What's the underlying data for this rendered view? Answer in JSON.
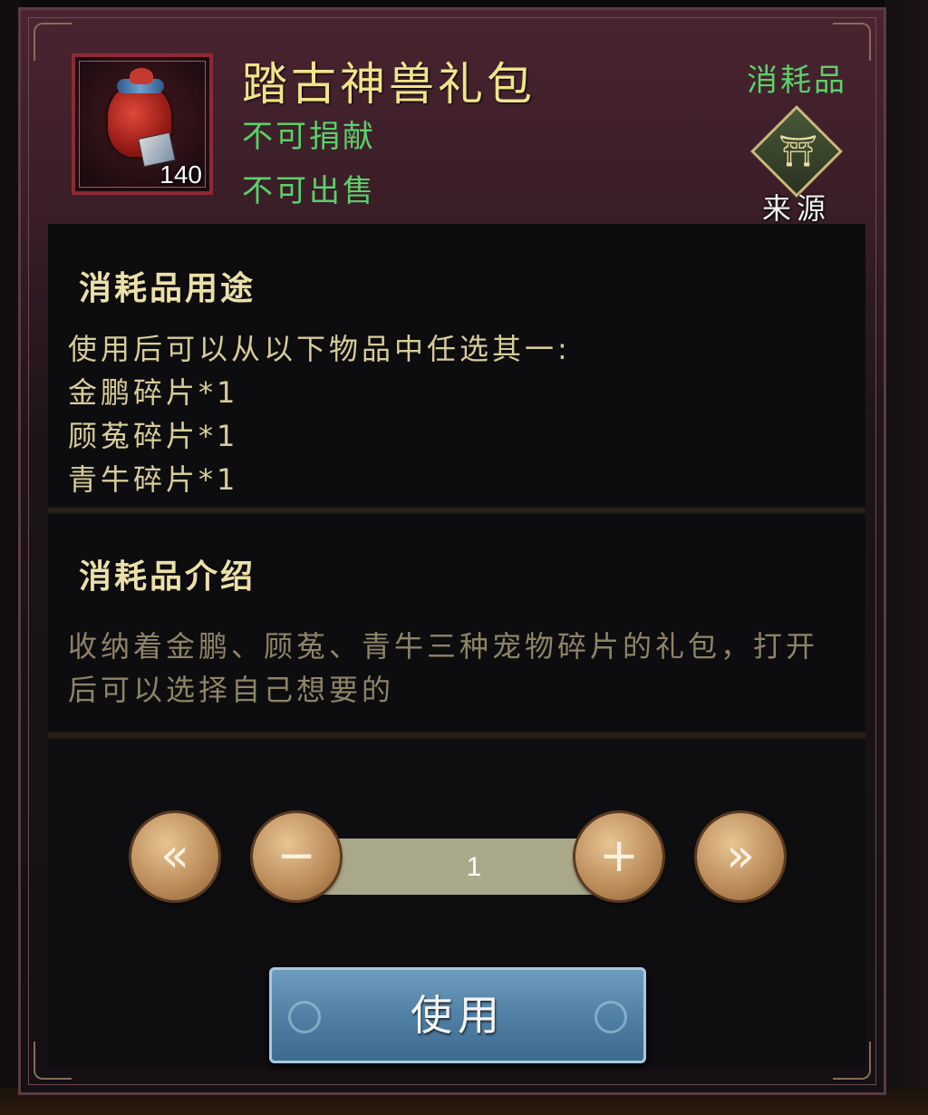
{
  "item": {
    "name": "踏古神兽礼包",
    "count": "140",
    "attributes": [
      "不可捐献",
      "不可出售"
    ],
    "type": "消耗品",
    "source_label": "来源",
    "icon": "gift-bag-icon",
    "source_icon": "castle-gate-icon"
  },
  "usage": {
    "heading": "消耗品用途",
    "lines": [
      "使用后可以从以下物品中任选其一:",
      "金鹏碎片*1",
      "顾菟碎片*1",
      "青牛碎片*1"
    ]
  },
  "intro": {
    "heading": "消耗品介绍",
    "text": "收纳着金鹏、顾菟、青牛三种宠物碎片的礼包，打开后可以选择自己想要的"
  },
  "quantity": {
    "value": "1",
    "min_icon": "double-left-arrow-icon",
    "minus_icon": "minus-icon",
    "plus_icon": "plus-icon",
    "max_icon": "double-right-arrow-icon"
  },
  "actions": {
    "use_label": "使用"
  },
  "colors": {
    "title": "#f0e48a",
    "attribute": "#5bd06a",
    "heading": "#ece0a8",
    "body": "#d8cc98",
    "desc": "#8e8466",
    "use_button": "#4f7ea3"
  }
}
